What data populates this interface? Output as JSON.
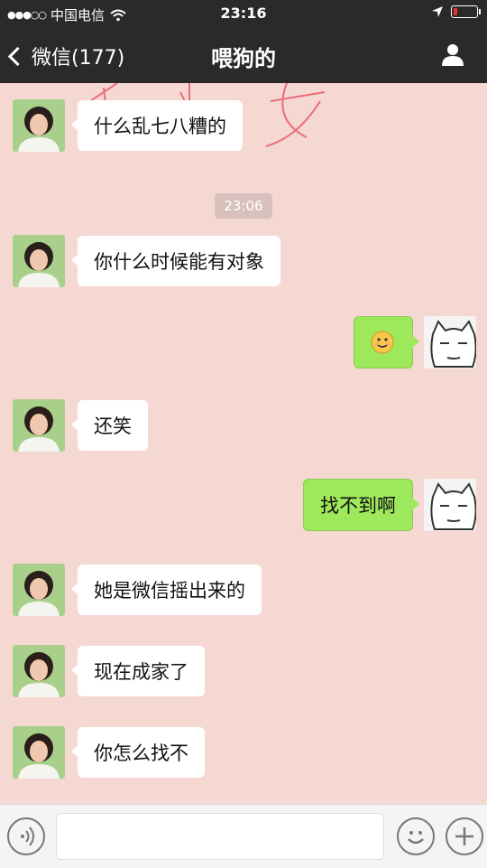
{
  "status_bar": {
    "signal": "●●●○○",
    "carrier": "中国电信",
    "time": "23:16"
  },
  "nav": {
    "back_label": "微信(177)",
    "title": "喂狗的"
  },
  "colors": {
    "navbar_bg": "#2a2a2a",
    "chat_bg": "#f6d8d3",
    "incoming_bubble": "#ffffff",
    "outgoing_bubble": "#9ee85b",
    "battery_low": "#e8332a"
  },
  "messages": [
    {
      "side": "in",
      "text": "什么乱七八糟的"
    },
    {
      "side": "in",
      "text": "你什么时候能有对象"
    },
    {
      "side": "out",
      "text": "",
      "emoji": "smile-emoji"
    },
    {
      "side": "in",
      "text": "还笑"
    },
    {
      "side": "out",
      "text": "找不到啊"
    },
    {
      "side": "in",
      "text": "她是微信摇出来的"
    },
    {
      "side": "in",
      "text": "现在成家了"
    },
    {
      "side": "in",
      "text": "你怎么找不"
    }
  ],
  "timestamp": "23:06",
  "input_bar": {
    "left_icon": "voice-icon",
    "emoji_icon": "emoji-icon",
    "plus_icon": "plus-icon"
  }
}
